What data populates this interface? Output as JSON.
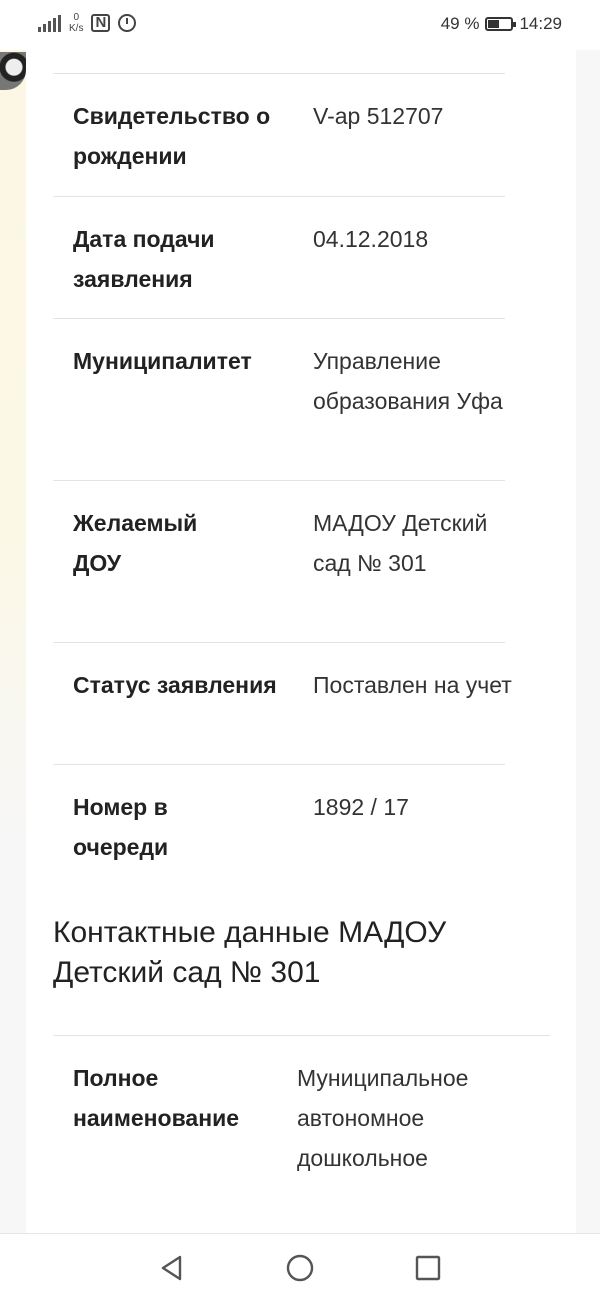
{
  "status_bar": {
    "network_speed_value": "0",
    "network_speed_unit": "K/s",
    "nfc": "N",
    "battery": "49 %",
    "battery_level": 0.49,
    "time": "14:29"
  },
  "application": {
    "rows": [
      {
        "label": "Свидетельство о рождении",
        "value": "V-ар 512707"
      },
      {
        "label": "Дата подачи заявления",
        "value": "04.12.2018"
      },
      {
        "label": "Муниципалитет",
        "value": "Управление образования Уфа"
      },
      {
        "label": "Желаемый ДОУ",
        "value": "МАДОУ Детский сад № 301"
      },
      {
        "label": "Статус заявления",
        "value": "Поставлен на учет"
      },
      {
        "label": "Номер в очереди",
        "value": "1892 / 17"
      }
    ]
  },
  "contacts": {
    "title": "Контактные данные МАДОУ Детский сад № 301",
    "rows": [
      {
        "label": "Полное наименование",
        "value": "Муниципальное автономное дошкольное"
      }
    ]
  },
  "nav_bar": {
    "icons": [
      "back-icon",
      "home-icon",
      "recent-apps-icon"
    ]
  }
}
